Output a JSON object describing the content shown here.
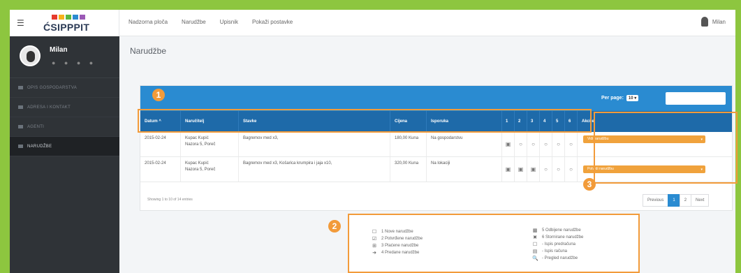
{
  "app": {
    "logo_text": "ĆSIPPPIT"
  },
  "topnav": [
    "Nadzorna ploča",
    "Narudžbe",
    "Upisnik",
    "Pokaži postavke"
  ],
  "user": {
    "name": "Milan",
    "sidebar_name": "Milan",
    "dots": "● ● ● ●"
  },
  "sidebar": {
    "items": [
      {
        "label": "OPIS GOSPODARSTVA"
      },
      {
        "label": "ADRESA I KONTAKT"
      },
      {
        "label": "AGENTI"
      },
      {
        "label": "NARUDŽBE"
      }
    ]
  },
  "page": {
    "title": "Narudžbe"
  },
  "table": {
    "per_page_label": "Per page:",
    "per_page_value": "10",
    "columns": [
      "Datum ^",
      "Naručitelj",
      "Stavke",
      "Cijena",
      "Isporuka",
      "1",
      "2",
      "3",
      "4",
      "5",
      "6",
      "Akcije"
    ],
    "rows": [
      {
        "date": "2015-02-24",
        "customer": "Kupac Kupić\nNazora 5, Poreč",
        "items": "Bagremov med x3,",
        "price": "180,00 Kuna",
        "delivery": "Na gospodarstvu",
        "status": [
          "▣",
          "○",
          "○",
          "○",
          "○",
          "○"
        ],
        "action": "Vidi narudžbu"
      },
      {
        "date": "2015-02-24",
        "customer": "Kupac Kupić\nNazora 5, Poreč",
        "items": "Bagremov med x3, Košarica krumpira i jaja x10,",
        "price": "320,00 Kuna",
        "delivery": "Na lokaciji",
        "status": [
          "▣",
          "▣",
          "▣",
          "○",
          "○",
          "○"
        ],
        "action": "Potvrdi narudžbu"
      }
    ],
    "showing": "Showing 1 to 10 of 14 entries",
    "pager": [
      "Previous",
      "1",
      "2",
      "Next"
    ]
  },
  "callouts": [
    "1",
    "2",
    "3"
  ],
  "legend": {
    "left": [
      {
        "icon": "☐",
        "text": "1  Nove narudžbe"
      },
      {
        "icon": "☑",
        "text": "2  Potvrđene narudžbe"
      },
      {
        "icon": "⊞",
        "text": "3  Plaćene narudžbe"
      },
      {
        "icon": "➜",
        "text": "4  Predane narudžbe"
      }
    ],
    "right": [
      {
        "icon": "▩",
        "text": "5  Odbijene narudžbe"
      },
      {
        "icon": "✖",
        "text": "6  Stornirane narudžbe"
      },
      {
        "icon": "☐",
        "text": "-  Ispis predračuna"
      },
      {
        "icon": "▤",
        "text": "-  Ispis računa"
      },
      {
        "icon": "🔍",
        "text": "-  Pregled narudžbe"
      }
    ]
  },
  "colors": {
    "accent": "#2a8bd1",
    "header": "#1e6aa9",
    "callout": "#f29b3a",
    "sidebar": "#2f3337",
    "frame": "#8dc63f"
  }
}
